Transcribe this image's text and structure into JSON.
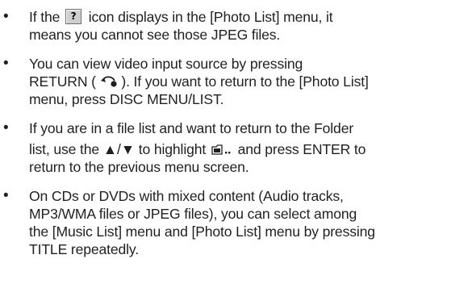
{
  "bullets": [
    {
      "lines": [
        {
          "before": "If the",
          "after": "icon displays in the [Photo List] menu, it"
        },
        {
          "text": "means you cannot see those JPEG files."
        }
      ]
    },
    {
      "lines": [
        {
          "text": "You can view video input source by pressing"
        },
        {
          "before": "RETURN (",
          "after": "). If you want to return to the [Photo List]"
        },
        {
          "text": "menu, press DISC MENU/LIST."
        }
      ]
    },
    {
      "lines": [
        {
          "text": "If you are in a file list and want to return to the Folder"
        },
        {
          "before": "list, use the ▲/▼ to highlight",
          "after": "and press ENTER to"
        },
        {
          "text": "return to the previous menu screen."
        }
      ]
    },
    {
      "lines": [
        {
          "text": "On CDs or DVDs with mixed content (Audio tracks,"
        },
        {
          "text": "MP3/WMA files or JPEG files), you can select among"
        },
        {
          "text": "the [Music List] menu and [Photo List] menu by pressing"
        },
        {
          "text": "TITLE repeatedly."
        }
      ]
    }
  ],
  "bullet_char": "•",
  "icons": {
    "unknown_file": {
      "name": "question-mark-file-icon",
      "glyph": "?"
    },
    "return": {
      "name": "return-arrow-icon"
    },
    "folder_up": {
      "name": "parent-folder-icon"
    }
  }
}
